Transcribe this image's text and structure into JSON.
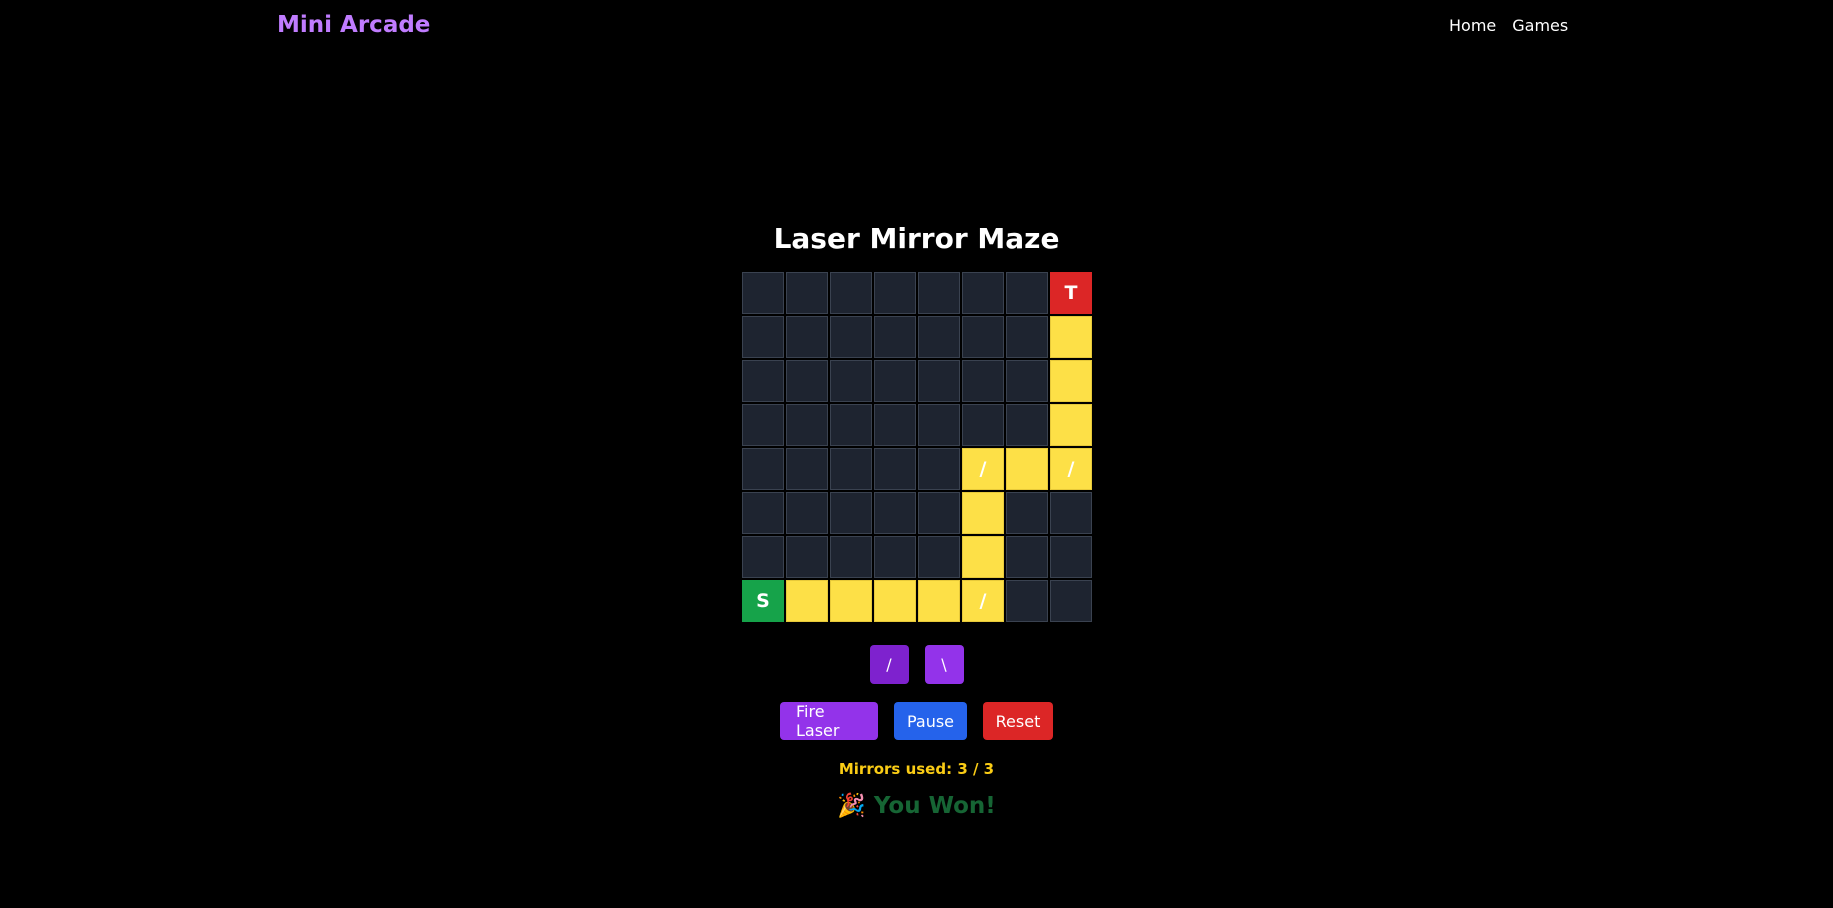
{
  "header": {
    "brand": "Mini Arcade",
    "nav": [
      {
        "label": "Home"
      },
      {
        "label": "Games"
      }
    ]
  },
  "game": {
    "title": "Laser Mirror Maze",
    "grid": {
      "rows": [
        [
          "",
          "",
          "",
          "",
          "",
          "",
          "",
          "T"
        ],
        [
          "",
          "",
          "",
          "",
          "",
          "",
          "",
          ""
        ],
        [
          "",
          "",
          "",
          "",
          "",
          "",
          "",
          ""
        ],
        [
          "",
          "",
          "",
          "",
          "",
          "",
          "",
          ""
        ],
        [
          "",
          "",
          "",
          "",
          "",
          "/",
          "",
          "/"
        ],
        [
          "",
          "",
          "",
          "",
          "",
          "",
          "",
          ""
        ],
        [
          "",
          "",
          "",
          "",
          "",
          "",
          "",
          ""
        ],
        [
          "S",
          "",
          "",
          "",
          "",
          "/",
          "",
          ""
        ]
      ],
      "cell_types": [
        [
          "e",
          "e",
          "e",
          "e",
          "e",
          "e",
          "e",
          "target"
        ],
        [
          "e",
          "e",
          "e",
          "e",
          "e",
          "e",
          "e",
          "laser"
        ],
        [
          "e",
          "e",
          "e",
          "e",
          "e",
          "e",
          "e",
          "laser"
        ],
        [
          "e",
          "e",
          "e",
          "e",
          "e",
          "e",
          "e",
          "laser"
        ],
        [
          "e",
          "e",
          "e",
          "e",
          "e",
          "laser",
          "laser",
          "laser"
        ],
        [
          "e",
          "e",
          "e",
          "e",
          "e",
          "laser",
          "e",
          "e"
        ],
        [
          "e",
          "e",
          "e",
          "e",
          "e",
          "laser",
          "e",
          "e"
        ],
        [
          "start",
          "laser",
          "laser",
          "laser",
          "laser",
          "laser",
          "e",
          "e"
        ]
      ]
    },
    "mirror_options": [
      "/",
      "\\"
    ],
    "controls": {
      "fire": "Fire Laser",
      "pause": "Pause",
      "reset": "Reset"
    },
    "mirrors_used": "Mirrors used: 3 / 3",
    "status_icon": "🎉",
    "status": "You Won!"
  },
  "colors": {
    "brand": "#c07cff",
    "laser": "#fde047",
    "start": "#16a34a",
    "target": "#dc2626",
    "status": "#166534",
    "mirrors_used": "#facc15"
  }
}
